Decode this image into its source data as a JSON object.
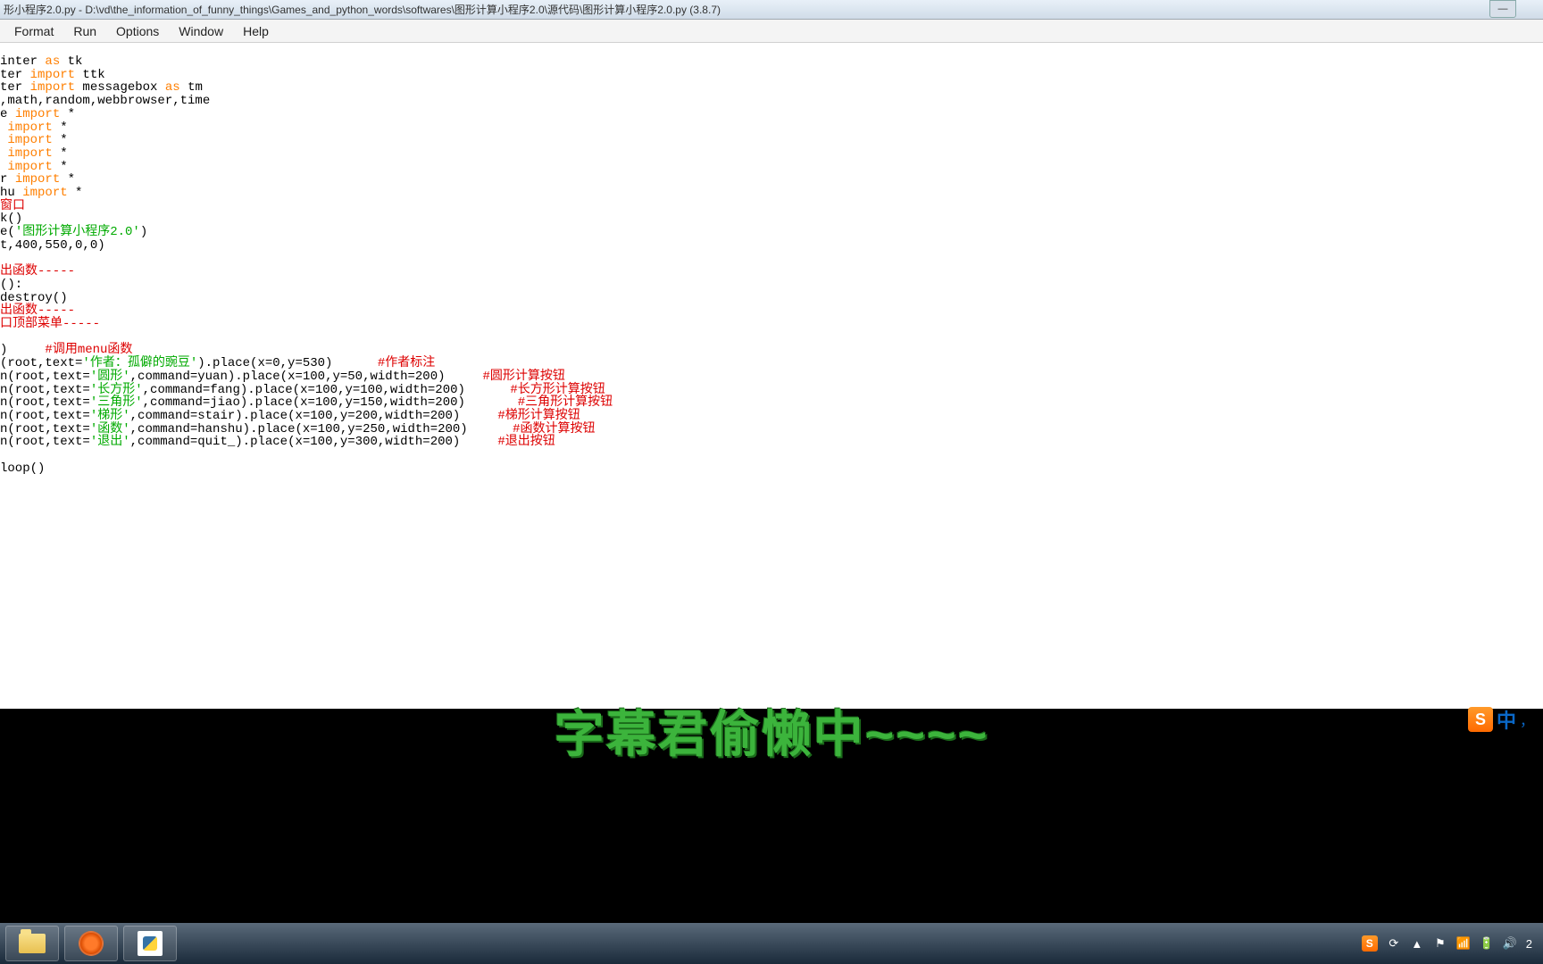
{
  "window": {
    "title": "形小程序2.0.py - D:\\vd\\the_information_of_funny_things\\Games_and_python_words\\softwares\\图形计算小程序2.0\\源代码\\图形计算小程序2.0.py (3.8.7)"
  },
  "menu": {
    "format": "Format",
    "run": "Run",
    "options": "Options",
    "window": "Window",
    "help": "Help"
  },
  "code": {
    "l01a": "inter ",
    "l01b": "as",
    "l01c": " tk",
    "l02a": "ter ",
    "l02b": "import",
    "l02c": " ttk",
    "l03a": "ter ",
    "l03b": "import",
    "l03c": " messagebox ",
    "l03d": "as",
    "l03e": " tm",
    "l04": ",math,random,webbrowser,time",
    "l05a": "e ",
    "l05b": "import",
    "l05c": " *",
    "l06a": " ",
    "l06b": "import",
    "l06c": " *",
    "l07a": " ",
    "l07b": "import",
    "l07c": " *",
    "l08a": " ",
    "l08b": "import",
    "l08c": " *",
    "l09a": " ",
    "l09b": "import",
    "l09c": " *",
    "l10a": "r ",
    "l10b": "import",
    "l10c": " *",
    "l11a": "hu ",
    "l11b": "import",
    "l11c": " *",
    "l12": "窗口",
    "l13": "k()",
    "l14a": "e(",
    "l14b": "'图形计算小程序2.0'",
    "l14c": ")",
    "l15": "t,400,550,0,0)",
    "l16": "",
    "l17": "出函数-----",
    "l18": "():",
    "l19": "destroy()",
    "l20": "出函数-----",
    "l21": "口顶部菜单-----",
    "l22": "",
    "l23a": ")     ",
    "l23b": "#调用menu函数",
    "l24a": "(root,text=",
    "l24b": "'作者：孤僻的豌豆'",
    "l24c": ").place(x=0,y=530)      ",
    "l24d": "#作者标注",
    "l25a": "n(root,text=",
    "l25b": "'圆形'",
    "l25c": ",command=yuan).place(x=100,y=50,width=200)     ",
    "l25d": "#圆形计算按钮",
    "l26a": "n(root,text=",
    "l26b": "'长方形'",
    "l26c": ",command=fang).place(x=100,y=100,width=200)      ",
    "l26d": "#长方形计算按钮",
    "l27a": "n(root,text=",
    "l27b": "'三角形'",
    "l27c": ",command=jiao).place(x=100,y=150,width=200)       ",
    "l27d": "#三角形计算按钮",
    "l28a": "n(root,text=",
    "l28b": "'梯形'",
    "l28c": ",command=stair).place(x=100,y=200,width=200)     ",
    "l28d": "#梯形计算按钮",
    "l29a": "n(root,text=",
    "l29b": "'函数'",
    "l29c": ",command=hanshu).place(x=100,y=250,width=200)      ",
    "l29d": "#函数计算按钮",
    "l30a": "n(root,text=",
    "l30b": "'退出'",
    "l30c": ",command=quit_).place(x=100,y=300,width=200)     ",
    "l30d": "#退出按钮",
    "l31": "",
    "l32": "loop()"
  },
  "subtitle": "字幕君偷懒中~~~~",
  "ime": {
    "s": "S",
    "zh": "中",
    "punct": "，"
  },
  "tray": {
    "s": "S",
    "time": "2"
  }
}
